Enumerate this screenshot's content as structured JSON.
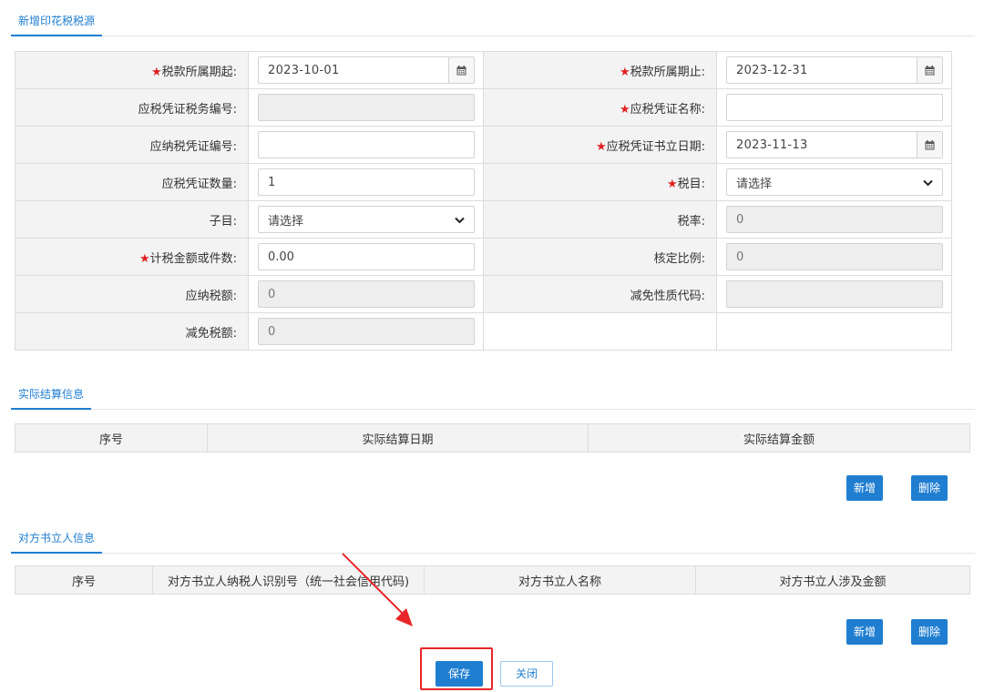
{
  "sections": {
    "source_title": "新增印花税税源",
    "settlement_title": "实际结算信息",
    "counterparty_title": "对方书立人信息"
  },
  "form": {
    "period_start": {
      "label": "税款所属期起:",
      "value": "2023-10-01"
    },
    "period_end": {
      "label": "税款所属期止:",
      "value": "2023-12-31"
    },
    "voucher_tax_no": {
      "label": "应税凭证税务编号:",
      "value": ""
    },
    "voucher_name": {
      "label": "应税凭证名称:",
      "value": ""
    },
    "taxable_voucher_no": {
      "label": "应纳税凭证编号:",
      "value": ""
    },
    "voucher_date": {
      "label": "应税凭证书立日期:",
      "value": "2023-11-13"
    },
    "voucher_count": {
      "label": "应税凭证数量:",
      "value": "1"
    },
    "tax_item": {
      "label": "税目:",
      "value": "请选择"
    },
    "sub_item": {
      "label": "子目:",
      "value": "请选择"
    },
    "tax_rate": {
      "label": "税率:",
      "value": "0"
    },
    "taxable_amount": {
      "label": "计税金额或件数:",
      "value": "0.00"
    },
    "approved_ratio": {
      "label": "核定比例:",
      "value": "0"
    },
    "tax_payable": {
      "label": "应纳税额:",
      "value": "0"
    },
    "exemption_code": {
      "label": "减免性质代码:",
      "value": ""
    },
    "tax_exemption": {
      "label": "减免税额:",
      "value": "0"
    }
  },
  "required_mark": "★",
  "settlement_table": {
    "headers": [
      "序号",
      "实际结算日期",
      "实际结算金额"
    ]
  },
  "counterparty_table": {
    "headers": [
      "序号",
      "对方书立人纳税人识别号（统一社会信用代码)",
      "对方书立人名称",
      "对方书立人涉及金额"
    ]
  },
  "buttons": {
    "add": "新增",
    "delete": "删除",
    "save": "保存",
    "close": "关闭"
  },
  "colors": {
    "accent": "#1f7ed0",
    "required": "#e02020",
    "annotation": "#e8262a"
  }
}
